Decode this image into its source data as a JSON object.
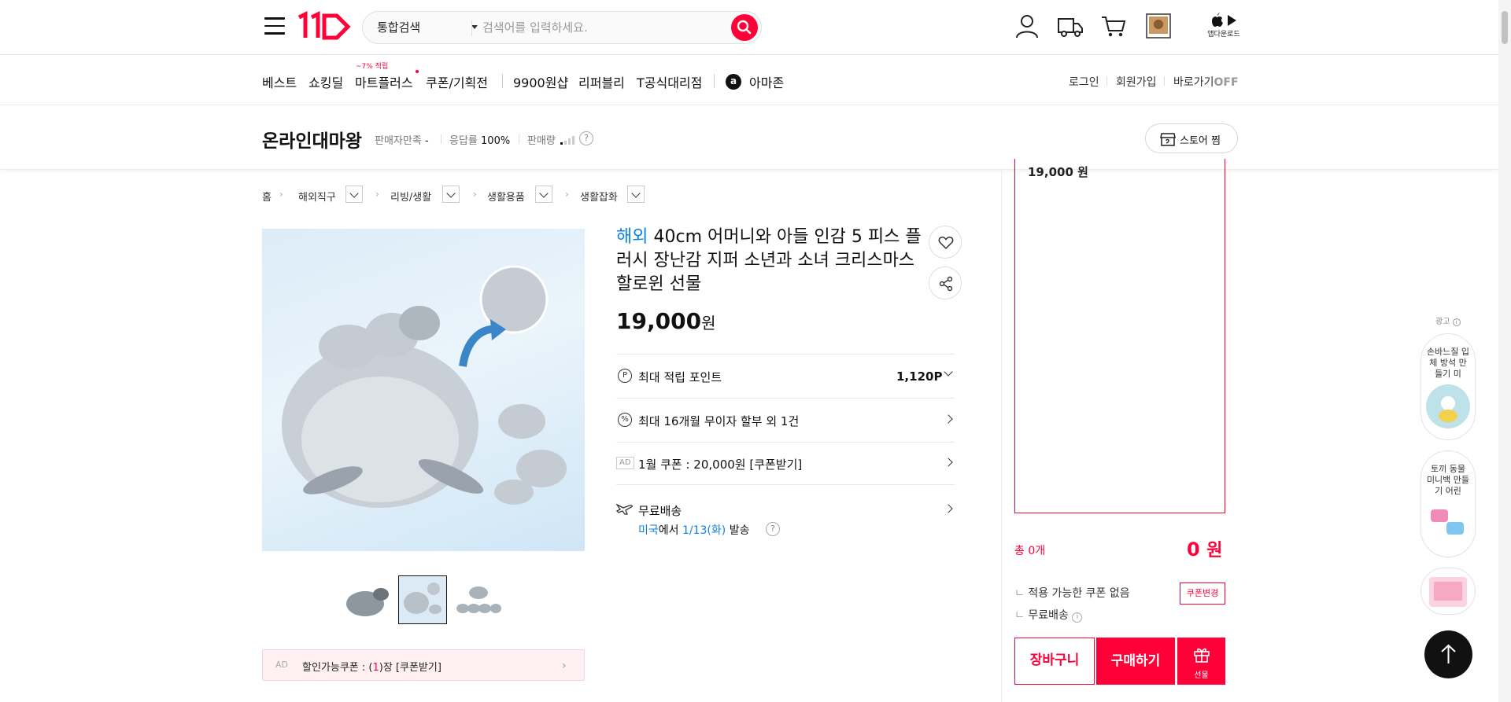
{
  "header": {
    "search_category": "통합검색",
    "search_placeholder": "검색어를 입력하세요.",
    "app_download": "앱다운로드"
  },
  "nav": {
    "items": [
      "베스트",
      "쇼킹딜",
      "마트플러스",
      "쿠폰/기획전",
      "9900원샵",
      "리퍼블리",
      "T공식대리점",
      "아마존"
    ],
    "mart_badge": "~7% 적립",
    "right": {
      "login": "로그인",
      "signup": "회원가입",
      "shortcut": "바로가기",
      "shortcut_state": "OFF"
    }
  },
  "seller": {
    "name": "온라인대마왕",
    "satisfaction_label": "판매자만족",
    "satisfaction_value": "-",
    "response_label": "응답률",
    "response_value": "100%",
    "sales_label": "판매량",
    "store_button": "스토어 찜"
  },
  "breadcrumb": [
    "홈",
    "해외직구",
    "리빙/생활",
    "생활용품",
    "생활잡화"
  ],
  "product": {
    "tag": "해외",
    "title": "40cm 어머니와 아들 인감 5 피스 플러시 장난감 지퍼 소년과 소녀 크리스마스 할로윈 선물",
    "price": "19,000",
    "currency": "원",
    "points_label": "최대 적립 포인트",
    "points_value": "1,120P",
    "installment": "최대 16개월 무이자 할부 외 1건",
    "ad_tag": "AD",
    "coupon_row": "1월 쿠폰 : 20,000원 [쿠폰받기]",
    "shipping_label": "무료배송",
    "shipping_origin": "미국",
    "shipping_mid": "에서",
    "shipping_date": "1/13(화)",
    "shipping_end": "발송"
  },
  "ad_coupon": {
    "ad": "AD",
    "text_pre": "할인가능쿠폰 : (",
    "count": "1",
    "text_post": ")장 [쿠폰받기]"
  },
  "order": {
    "box_price": "19,000 원",
    "total_label": "총 0개",
    "total_value": "0",
    "total_unit": "원",
    "coupon_none": "적용 가능한 쿠폰 없음",
    "coupon_change": "쿠폰변경",
    "free_ship": "무료배송",
    "cart": "장바구니",
    "buy": "구매하기",
    "gift": "선물"
  },
  "side_ads": {
    "label": "광고",
    "ad1": "손바느질 입체 방석 만들기 미",
    "ad2": "토끼 동물 미니백 만들기 어린"
  },
  "colors": {
    "brand": "#ff0038",
    "link": "#0b83e6"
  }
}
